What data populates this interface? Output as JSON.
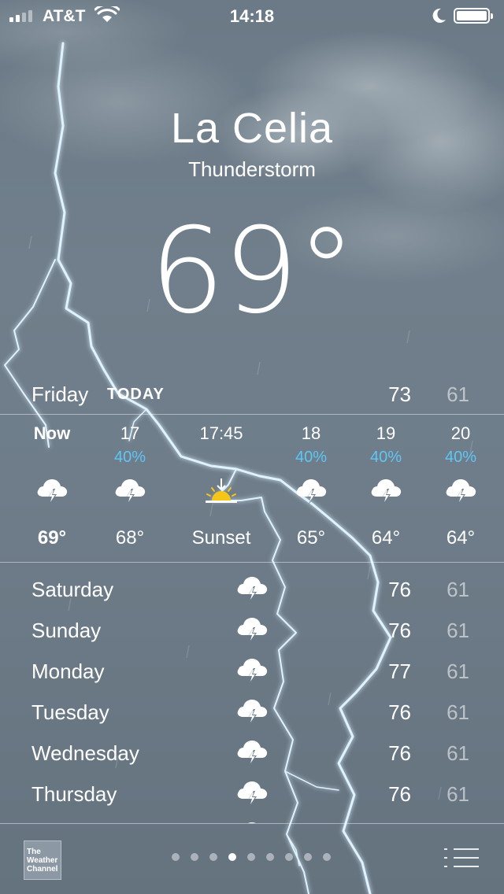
{
  "status_bar": {
    "carrier": "AT&T",
    "time": "14:18",
    "signal_bars": 4,
    "signal_bars_active": 2,
    "battery_level": 1.0
  },
  "location": {
    "city": "La Celia",
    "condition": "Thunderstorm",
    "temperature": "69°"
  },
  "today": {
    "day": "Friday",
    "label": "TODAY",
    "high": "73",
    "low": "61"
  },
  "hourly": [
    {
      "time": "Now",
      "chance": "",
      "icon": "thunderstorm-icon",
      "temp": "69°"
    },
    {
      "time": "17",
      "chance": "40%",
      "icon": "thunderstorm-icon",
      "temp": "68°"
    },
    {
      "time": "17:45",
      "chance": "",
      "icon": "sunset-icon",
      "temp": "Sunset"
    },
    {
      "time": "18",
      "chance": "40%",
      "icon": "thunderstorm-icon",
      "temp": "65°"
    },
    {
      "time": "19",
      "chance": "40%",
      "icon": "thunderstorm-icon",
      "temp": "64°"
    },
    {
      "time": "20",
      "chance": "40%",
      "icon": "thunderstorm-icon",
      "temp": "64°"
    }
  ],
  "daily": [
    {
      "day": "Saturday",
      "icon": "thunderstorm-icon",
      "high": "76",
      "low": "61"
    },
    {
      "day": "Sunday",
      "icon": "thunderstorm-icon",
      "high": "76",
      "low": "61"
    },
    {
      "day": "Monday",
      "icon": "thunderstorm-icon",
      "high": "77",
      "low": "61"
    },
    {
      "day": "Tuesday",
      "icon": "thunderstorm-icon",
      "high": "76",
      "low": "61"
    },
    {
      "day": "Wednesday",
      "icon": "thunderstorm-icon",
      "high": "76",
      "low": "61"
    },
    {
      "day": "Thursday",
      "icon": "thunderstorm-icon",
      "high": "76",
      "low": "61"
    }
  ],
  "footer": {
    "logo_text": "The Weather Channel",
    "page_count": 9,
    "active_page": 4
  },
  "colors": {
    "background": "#6e7d89",
    "precip_chance": "#5fc6f5",
    "sun": "#f5c518"
  }
}
